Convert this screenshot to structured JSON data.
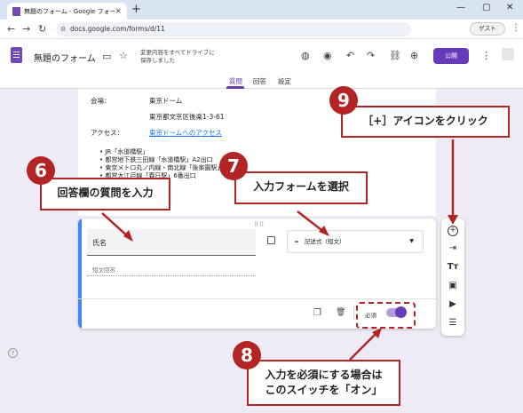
{
  "browser": {
    "tab_title": "無題のフォーム - Google フォーム",
    "tab_close": "×",
    "new_tab": "+",
    "url": "docs.google.com/forms/d/11",
    "guest_label": "ゲスト",
    "win_min": "—",
    "win_max": "▢",
    "win_close": "✕",
    "back": "←",
    "forward": "→",
    "reload": "↻",
    "kebab": "⋮"
  },
  "header": {
    "form_title": "無題のフォーム",
    "save_note_line1": "変更内容をすべてドライブに",
    "save_note_line2": "保存しました",
    "publish_label": "公開",
    "tabs": [
      "質問",
      "回答",
      "設定"
    ]
  },
  "info": {
    "venue_label": "会場：",
    "venue_value": "東京ドーム",
    "address": "東京都文京区後楽1-3-61",
    "access_label": "アクセス：",
    "access_link": "東京ドームへのアクセス",
    "bullets": [
      "• JR「水道橋駅」",
      "• 都営地下鉄三田線「水道橋駅」A2出口",
      "• 東京メトロ丸ノ内線・南北線「後楽園駅」",
      "• 都営大江戸線「春日駅」6番出口"
    ]
  },
  "question": {
    "drag_handle": "⠿⠿",
    "title_value": "氏名",
    "answer_placeholder": "短文回答",
    "type_selected": "記述式（短文）",
    "type_icon": "═",
    "required_label": "必須",
    "required_on": true
  },
  "side_toolbar": {
    "icons": [
      "add-question-icon",
      "import-questions-icon",
      "add-title-icon",
      "add-image-icon",
      "add-video-icon",
      "add-section-icon"
    ]
  },
  "annotations": {
    "callout6": "回答欄の質問を入力",
    "callout7": "入力フォームを選択",
    "callout8_line1": "入力を必須にする場合は",
    "callout8_line2": "このスイッチを「オン」",
    "callout9": "［+］アイコンをクリック",
    "badges": [
      "6",
      "7",
      "8",
      "9"
    ],
    "accent_color": "#b32424"
  },
  "help": "?"
}
